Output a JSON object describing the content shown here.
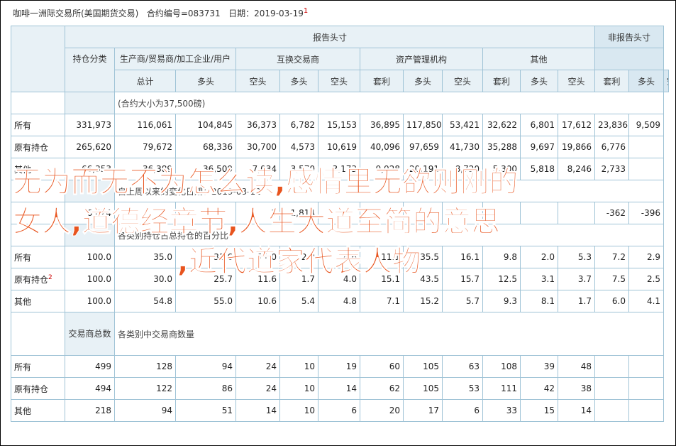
{
  "header": {
    "exchange": "咖啡一洲际交易所(美国期货交易)",
    "contract": "合约编号=083731",
    "date": "日期：2019-03-19",
    "date_mark": "1"
  },
  "table": {
    "group_report": "报告头寸",
    "group_nonreport": "非报告头寸",
    "col_category": "持仓分类",
    "col_producer": "生产商/贸易商/加工企业/用户",
    "col_swap": "互换交易商",
    "col_asset": "资产管理机构",
    "col_other": "其他",
    "sub_total": "总计",
    "sub_long": "多头",
    "sub_short": "空头",
    "sub_spread": "套利",
    "note_contract": "(合约大小为37,500磅)",
    "note_change": "自上周以来的变化日期：2019-03-12",
    "note_pct": "各类别持仓占总持仓的百分比",
    "note_traders_title": "交易商总数",
    "note_traders": "各类别中交易商数量",
    "label_all": "所有",
    "label_old": "原有持仓",
    "label_other": "其他",
    "pct_old_mark": "2",
    "rows_positions": [
      {
        "label": "所有",
        "vals": [
          "331,973",
          "116,061",
          "104,845",
          "36,373",
          "6,782",
          "15,153",
          "36,895",
          "117,850",
          "53,421",
          "32,622",
          "6,801",
          "17,612",
          "23,836",
          "9,509"
        ]
      },
      {
        "label": "原有持仓",
        "vals": [
          "265,620",
          "79,672",
          "68,336",
          "30,700",
          "4,573",
          "10,619",
          "40,096",
          "97,659",
          "41,730",
          "35,288",
          "9,697",
          "19,866",
          "6,776"
        ]
      },
      {
        "label": "其他",
        "vals": [
          "66,353",
          "36,389",
          "36,509",
          "7,034",
          "3,570",
          "3,173",
          "9,928",
          "20,191",
          "8,720",
          "5,300",
          "5,818",
          "8,246",
          "2,733"
        ]
      }
    ],
    "row_change": {
      "label": "",
      "vals": [
        "6,824",
        "",
        "",
        "3",
        "1,814",
        "",
        "",
        "",
        "",
        "",
        "",
        "",
        "-362",
        "-396"
      ]
    },
    "rows_pct": [
      {
        "label": "所有",
        "vals": [
          "100.0",
          "35.0",
          "31.6",
          "11.0",
          "2.0",
          "4.6",
          "11.1",
          "35.5",
          "16.1",
          "9.8",
          "2.0",
          "5.3",
          "7.2",
          "2.9"
        ]
      },
      {
        "label": "原有持仓",
        "vals": [
          "100.0",
          "30.0",
          "25.7",
          "11.6",
          "1.7",
          "4.0",
          "15.1",
          "43.5",
          "15.7",
          "12.5",
          "3.1",
          "3.7",
          "7.5",
          "2.5"
        ]
      },
      {
        "label": "其他",
        "vals": [
          "100.0",
          "54.8",
          "55.0",
          "10.6",
          "5.4",
          "4.8",
          "7.1",
          "15.2",
          "5.7",
          "9.3",
          "8.1",
          "1.7",
          "6.0",
          "4.1"
        ]
      }
    ],
    "rows_traders": [
      {
        "label": "所有",
        "vals": [
          "499",
          "128",
          "94",
          "24",
          "10",
          "19",
          "60",
          "105",
          "63",
          "108",
          "39",
          "48"
        ]
      },
      {
        "label": "原有持仓",
        "vals": [
          "494",
          "122",
          "86",
          "24",
          "10",
          "14",
          "62",
          "105",
          "53",
          "111",
          "42",
          "38"
        ]
      },
      {
        "label": "其他",
        "vals": [
          "218",
          "94",
          "51",
          "14",
          "10",
          "6",
          "20",
          "17",
          "6",
          "33",
          "15",
          "14"
        ]
      }
    ]
  },
  "overlay": {
    "line1": "无为而无不为怎么读,感情里无欲则刚的",
    "line2": "女人,道德经章节,人生大道至简的意思",
    "line3": ",近代道家代表人物"
  }
}
